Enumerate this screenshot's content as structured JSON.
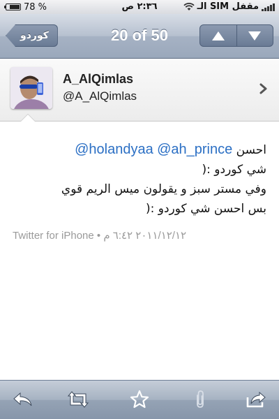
{
  "status_bar": {
    "battery_percent": "78 %",
    "battery_level": 0.78,
    "time": "٢:٣٦ ص",
    "carrier": "الـ SIM مقفل"
  },
  "nav": {
    "back_label": "كوردو",
    "title": "20 of 50"
  },
  "profile": {
    "name": "A_AlQimlas",
    "handle": "@A_AlQimlas"
  },
  "tweet": {
    "word": "احسن",
    "mention_1": "@ah_prince",
    "mention_2": "@holandyaa",
    "line_2": "شي كوردو :(",
    "line_3": "وفي مستر سبز و يقولون ميس الريم قوي",
    "line_4": "بس احسن شي كوردو :(",
    "meta": "Twitter for iPhone • ٢٠١١/١٢/١٢ ٦:٤٢ م"
  },
  "toolbar": {
    "icons": [
      "reply-icon",
      "retweet-icon",
      "star-icon",
      "paperclip-icon",
      "share-icon"
    ]
  },
  "colors": {
    "mention": "#2b6fc4",
    "nav_bar": "#a6b2c4",
    "meta_text": "#9a9a9a"
  }
}
